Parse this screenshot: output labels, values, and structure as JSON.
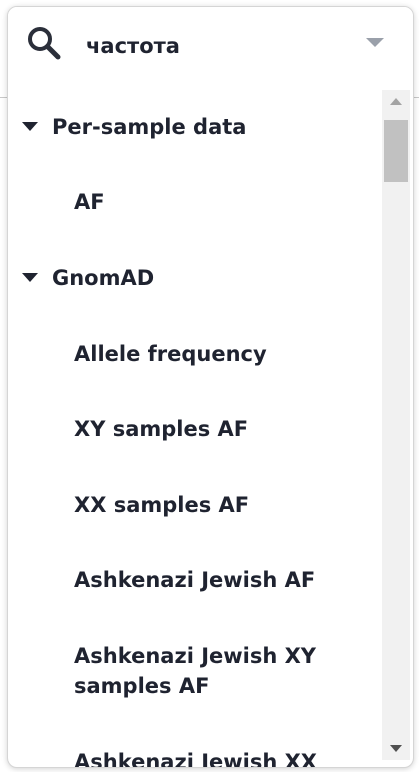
{
  "search": {
    "value": "частота",
    "icon": "search-icon",
    "dropdown_icon": "chevron-down-icon"
  },
  "groups": [
    {
      "label": "Per-sample data",
      "expanded": true,
      "items": [
        "AF"
      ]
    },
    {
      "label": "GnomAD",
      "expanded": true,
      "items": [
        "Allele frequency",
        "XY samples AF",
        "XX samples AF",
        "Ashkenazi Jewish AF",
        "Ashkenazi Jewish XY samples AF",
        "Ashkenazi Jewish XX"
      ]
    }
  ],
  "scrollbar": {
    "position": 0.0
  },
  "colors": {
    "text": "#1f2330",
    "border": "#d5d5d5",
    "chevron": "#9aa0aa",
    "scrollbar_track": "#f1f1f1",
    "scrollbar_thumb": "#c1c1c1"
  }
}
